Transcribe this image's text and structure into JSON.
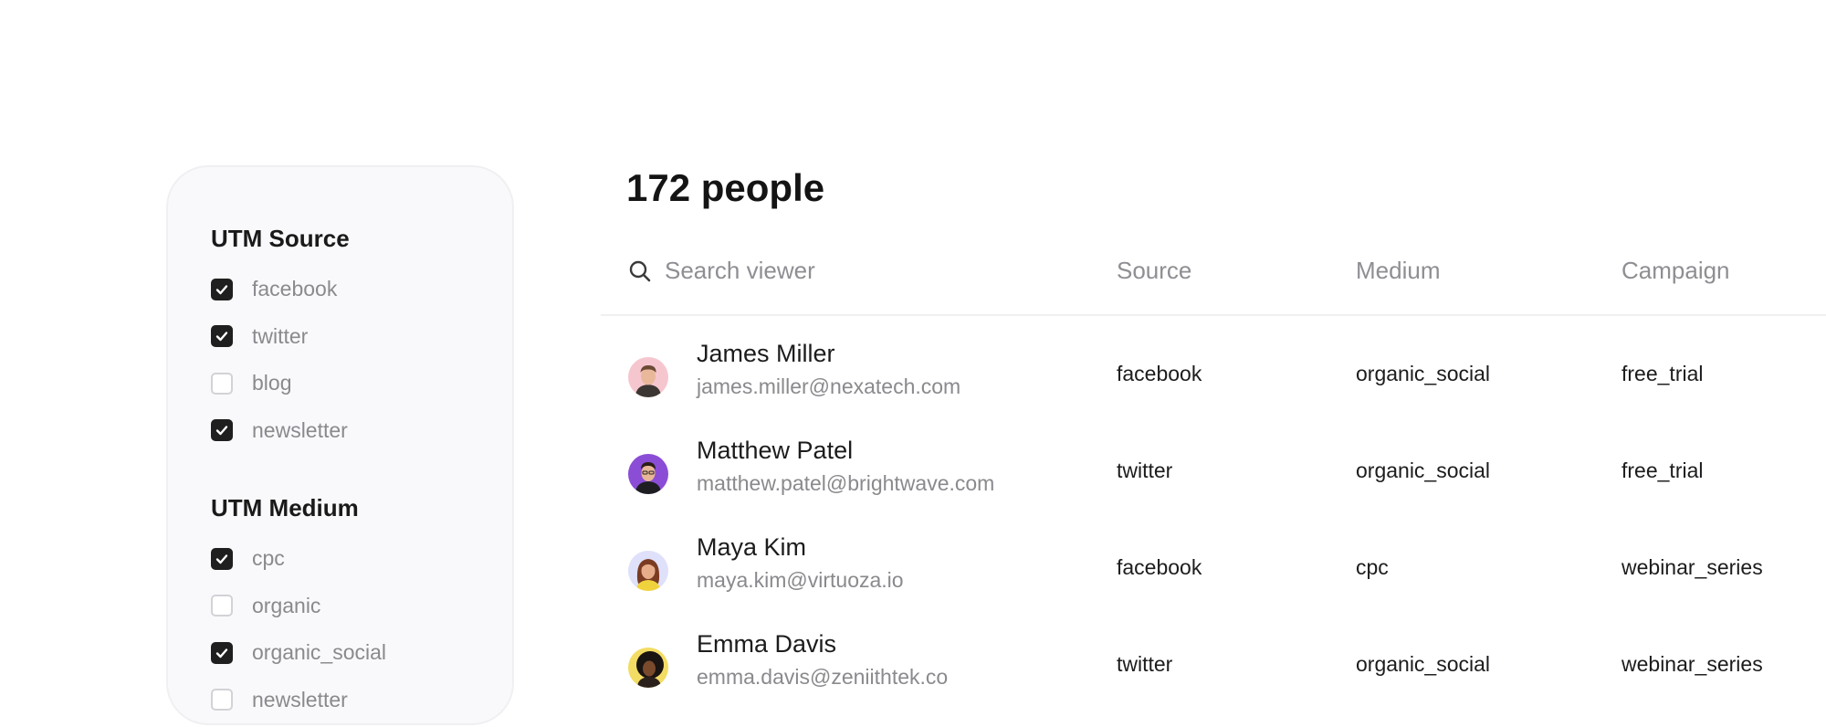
{
  "filters": {
    "utm_source": {
      "title": "UTM Source",
      "options": [
        {
          "label": "facebook",
          "checked": true
        },
        {
          "label": "twitter",
          "checked": true
        },
        {
          "label": "blog",
          "checked": false
        },
        {
          "label": "newsletter",
          "checked": true
        }
      ]
    },
    "utm_medium": {
      "title": "UTM Medium",
      "options": [
        {
          "label": "cpc",
          "checked": true
        },
        {
          "label": "organic",
          "checked": false
        },
        {
          "label": "organic_social",
          "checked": true
        },
        {
          "label": "newsletter",
          "checked": false
        }
      ]
    }
  },
  "main": {
    "title": "172 people",
    "search": {
      "placeholder": "Search viewer",
      "value": ""
    },
    "columns": {
      "source": "Source",
      "medium": "Medium",
      "campaign": "Campaign"
    },
    "rows": [
      {
        "name": "James Miller",
        "email": "james.miller@nexatech.com",
        "source": "facebook",
        "medium": "organic_social",
        "campaign": "free_trial",
        "avatar_bg": "#f6c6cf"
      },
      {
        "name": "Matthew Patel",
        "email": "matthew.patel@brightwave.com",
        "source": "twitter",
        "medium": "organic_social",
        "campaign": "free_trial",
        "avatar_bg": "#8b4dd6"
      },
      {
        "name": "Maya Kim",
        "email": "maya.kim@virtuoza.io",
        "source": "facebook",
        "medium": "cpc",
        "campaign": "webinar_series",
        "avatar_bg": "#dfe0fa"
      },
      {
        "name": "Emma Davis",
        "email": "emma.davis@zeniithtek.co",
        "source": "twitter",
        "medium": "organic_social",
        "campaign": "webinar_series",
        "avatar_bg": "#f3dc63"
      }
    ]
  },
  "icons": {
    "search": "search-icon",
    "check": "check-icon",
    "avatar": "avatar"
  },
  "colors": {
    "checkbox_checked": "#1f1f1f",
    "panel_bg": "#f9f9fb",
    "muted_text": "#8e8e93"
  }
}
